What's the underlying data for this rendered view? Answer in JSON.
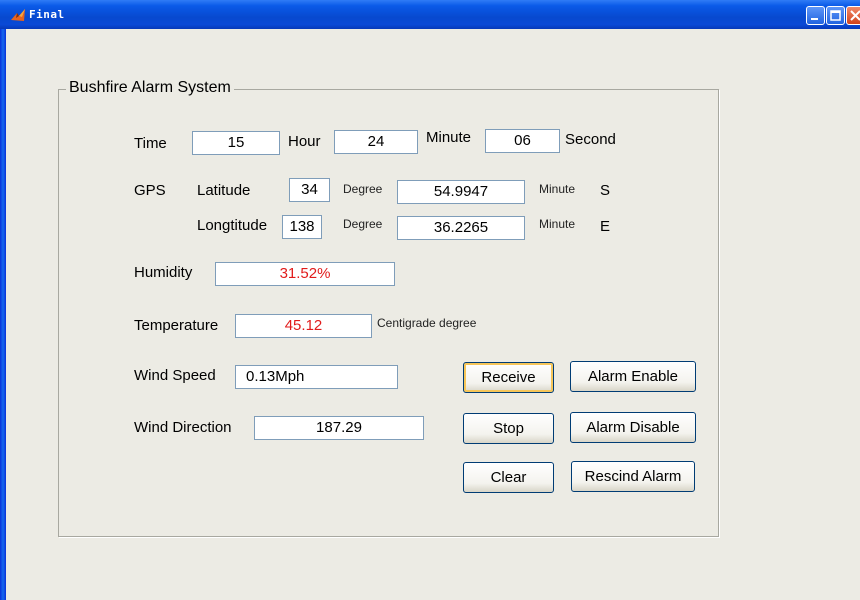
{
  "window": {
    "title": "Final"
  },
  "panel": {
    "title": "Bushfire Alarm System"
  },
  "time": {
    "label": "Time",
    "hour_value": "15",
    "hour_label": "Hour",
    "minute_value": "24",
    "minute_label": "Minute",
    "second_value": "06",
    "second_label": "Second"
  },
  "gps": {
    "label": "GPS",
    "latitude": {
      "label": "Latitude",
      "degree": "34",
      "degree_label": "Degree",
      "minute": "54.9947",
      "minute_label": "Minute",
      "hemisphere": "S"
    },
    "longitude": {
      "label": "Longtitude",
      "degree": "138",
      "degree_label": "Degree",
      "minute": "36.2265",
      "minute_label": "Minute",
      "hemisphere": "E"
    }
  },
  "humidity": {
    "label": "Humidity",
    "value": "31.52%"
  },
  "temperature": {
    "label": "Temperature",
    "value": "45.12",
    "unit": "Centigrade degree"
  },
  "wind_speed": {
    "label": "Wind Speed",
    "value": "0.13Mph"
  },
  "wind_direction": {
    "label": "Wind Direction",
    "value": "187.29"
  },
  "buttons": {
    "receive": "Receive",
    "stop": "Stop",
    "clear": "Clear",
    "alarm_enable": "Alarm Enable",
    "alarm_disable": "Alarm Disable",
    "rescind_alarm": "Rescind Alarm"
  },
  "colors": {
    "title_bar": "#0a5ae8",
    "window_bg": "#ecebe4",
    "alert_text": "#e11b1b",
    "button_border": "#003c74",
    "focus_ring": "#f6c65a"
  }
}
